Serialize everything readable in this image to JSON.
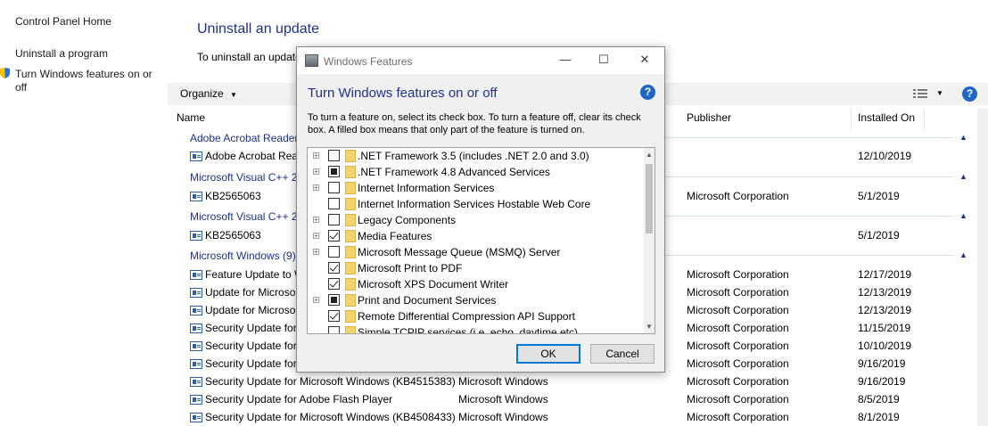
{
  "left_nav": {
    "home": "Control Panel Home",
    "uninstall": "Uninstall a program",
    "features": "Turn Windows features on or off"
  },
  "main": {
    "title": "Uninstall an update",
    "subtitle": "To uninstall an update",
    "organize": "Organize",
    "columns": {
      "name": "Name",
      "publisher": "Publisher",
      "installed_on": "Installed On"
    }
  },
  "groups": [
    {
      "label": "Adobe Acrobat Reader"
    },
    {
      "label": "Microsoft Visual C++ 2"
    },
    {
      "label": "Microsoft Visual C++ 2"
    },
    {
      "label": "Microsoft Windows (9)"
    }
  ],
  "rows": [
    {
      "name": "Adobe Acrobat Rea",
      "program": "",
      "publisher": "",
      "date": "12/10/2019"
    },
    {
      "name": "KB2565063",
      "program": "",
      "publisher": "Microsoft Corporation",
      "date": "5/1/2019"
    },
    {
      "name": "KB2565063",
      "program": "",
      "publisher": "",
      "date": "5/1/2019"
    },
    {
      "name": "Feature Update to W",
      "program": "",
      "publisher": "Microsoft Corporation",
      "date": "12/17/2019"
    },
    {
      "name": "Update for Microso",
      "program": "",
      "publisher": "Microsoft Corporation",
      "date": "12/13/2019"
    },
    {
      "name": "Update for Microso",
      "program": "",
      "publisher": "Microsoft Corporation",
      "date": "12/13/2019"
    },
    {
      "name": "Security Update for",
      "program": "",
      "publisher": "Microsoft Corporation",
      "date": "11/15/2019"
    },
    {
      "name": "Security Update for",
      "program": "",
      "publisher": "Microsoft Corporation",
      "date": "10/10/2019"
    },
    {
      "name": "Security Update for",
      "program": "",
      "publisher": "Microsoft Corporation",
      "date": "9/16/2019"
    },
    {
      "name": "Security Update for Microsoft Windows (KB4515383)",
      "program": "Microsoft Windows",
      "publisher": "Microsoft Corporation",
      "date": "9/16/2019"
    },
    {
      "name": "Security Update for Adobe Flash Player",
      "program": "Microsoft Windows",
      "publisher": "Microsoft Corporation",
      "date": "8/5/2019"
    },
    {
      "name": "Security Update for Microsoft Windows (KB4508433)",
      "program": "Microsoft Windows",
      "publisher": "Microsoft Corporation",
      "date": "8/1/2019"
    }
  ],
  "dialog": {
    "title": "Windows Features",
    "heading": "Turn Windows features on or off",
    "description": "To turn a feature on, select its check box. To turn a feature off, clear its check box. A filled box means that only part of the feature is turned on.",
    "ok": "OK",
    "cancel": "Cancel",
    "features": [
      {
        "label": ".NET Framework 3.5 (includes .NET 2.0 and 3.0)",
        "state": "unchecked",
        "expandable": true
      },
      {
        "label": ".NET Framework 4.8 Advanced Services",
        "state": "partial",
        "expandable": true
      },
      {
        "label": "Internet Information Services",
        "state": "unchecked",
        "expandable": true
      },
      {
        "label": "Internet Information Services Hostable Web Core",
        "state": "unchecked",
        "expandable": false
      },
      {
        "label": "Legacy Components",
        "state": "unchecked",
        "expandable": true
      },
      {
        "label": "Media Features",
        "state": "checked",
        "expandable": true
      },
      {
        "label": "Microsoft Message Queue (MSMQ) Server",
        "state": "unchecked",
        "expandable": true
      },
      {
        "label": "Microsoft Print to PDF",
        "state": "checked",
        "expandable": false
      },
      {
        "label": "Microsoft XPS Document Writer",
        "state": "checked",
        "expandable": false
      },
      {
        "label": "Print and Document Services",
        "state": "partial",
        "expandable": true
      },
      {
        "label": "Remote Differential Compression API Support",
        "state": "checked",
        "expandable": false
      },
      {
        "label": "Simple TCPIP services (i.e. echo, daytime etc)",
        "state": "unchecked",
        "expandable": false
      }
    ]
  },
  "icons": {
    "help": "?",
    "expander": "+",
    "minimize": "—",
    "maximize": "☐",
    "close": "✕",
    "caret_up": "▲",
    "caret_down": "▼",
    "organize_caret": "▼"
  }
}
